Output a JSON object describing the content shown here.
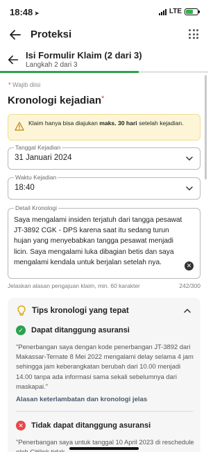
{
  "status_bar": {
    "time": "18:48",
    "network": "LTE"
  },
  "appbar": {
    "title": "Proteksi"
  },
  "step": {
    "title": "Isi Formulir Klaim (2 dari 3)",
    "subtitle": "Langkah 2 dari 3",
    "progress": 0.667
  },
  "form": {
    "required_note": "Wajib diisi",
    "section_title": "Kronologi kejadian",
    "warning": {
      "pre": "Klaim hanya bisa diajukan ",
      "bold": "maks. 30 hari",
      "post": " setelah kejadian."
    },
    "date_field": {
      "label": "Tanggal Kejadian",
      "value": "31 Januari 2024"
    },
    "time_field": {
      "label": "Waktu Kejadian",
      "value": "18:40"
    },
    "description_field": {
      "label": "Detail Kronologi",
      "value": "Saya mengalami insiden terjatuh dari tangga pesawat JT-3892 CGK - DPS karena saat itu sedang turun hujan yang menyebabkan tangga pesawat menjadi licin. Saya mengalami luka dibagian betis dan saya mengalami kendala untuk berjalan setelah nya."
    },
    "helper_text": "Jelaskan alasan pengajuan klaim, min. 60 karakter",
    "char_count": "242/300"
  },
  "tips": {
    "title": "Tips kronologi yang tepat",
    "covered": {
      "title": "Dapat ditanggung asuransi",
      "example": "\"Penerbangan saya dengan kode penerbangan JT-3892 dari Makassar-Ternate 8 Mei 2022 mengalami delay selama 4 jam sehingga jam keberangkatan berubah dari 10.00 menjadi 14.00 tanpa ada informasi sama sekali sebelumnya dari maskapai.\"",
      "link": "Alasan keterlambatan dan kronologi jelas"
    },
    "not_covered": {
      "title": "Tidak dapat ditanggung asuransi",
      "example": "\"Penerbangan saya untuk tanggal 10 April 2023 di reschedule oleh Citilink tidak..."
    }
  },
  "colors": {
    "accent_green": "#2ca24e",
    "danger_red": "#e5484d",
    "warning_bg": "#fdf5d8"
  },
  "icons": [
    "back-arrow-icon",
    "grid-menu-icon",
    "warning-icon",
    "chevron-down-icon",
    "clear-icon",
    "lightbulb-icon",
    "chevron-up-icon",
    "check-icon",
    "close-icon"
  ]
}
